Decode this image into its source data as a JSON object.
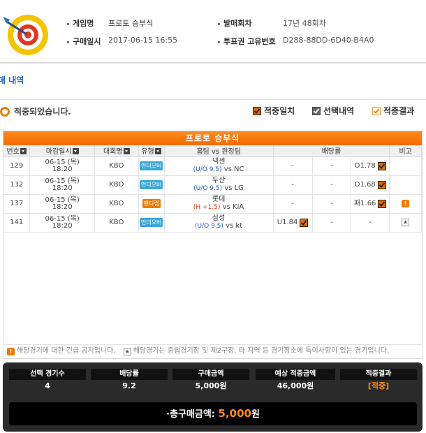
{
  "header": {
    "game_label": "게임명",
    "game_value": "프로토 승부식",
    "buy_time_label": "구매일시",
    "buy_time_value": "2017-06-15 16:55",
    "round_label": "발매회차",
    "round_value": "17년 48회차",
    "ticket_label": "투표권 고유번호",
    "ticket_value": "D288-88DD-6D40-B4A0"
  },
  "section_title": "매 내역",
  "status_text": "적중되었습니다.",
  "legend": {
    "hit": "적중일치",
    "selected": "선택내역",
    "result": "적중결과"
  },
  "table": {
    "title": "프로토 승부식",
    "headers": {
      "no": "번호",
      "deadline": "마감일시",
      "league": "대회명",
      "type": "유형",
      "teams": "홈팀 vs 원정팀",
      "odds": "배당률",
      "note": "비고"
    },
    "rows": [
      {
        "no": "129",
        "date": "06-15 (목)",
        "time": "18:20",
        "league": "KBO",
        "type": "언더오버",
        "home": "넥센",
        "sub": "(U/O 9.5)",
        "away": "vs NC",
        "o1": "-",
        "o2": "-",
        "o3": "O1.78",
        "note": ""
      },
      {
        "no": "132",
        "date": "06-15 (목)",
        "time": "18:20",
        "league": "KBO",
        "type": "언더오버",
        "home": "두산",
        "sub": "(U/O 9.5)",
        "away": "vs LG",
        "o1": "-",
        "o2": "-",
        "o3": "O1.68",
        "note": ""
      },
      {
        "no": "137",
        "date": "06-15 (목)",
        "time": "18:20",
        "league": "KBO",
        "type": "핸디캡",
        "home": "롯데",
        "sub": "(H +1.5)",
        "away": "vs KIA",
        "o1": "-",
        "o2": "-",
        "o3": "패1.66",
        "note": "!"
      },
      {
        "no": "141",
        "date": "06-15 (목)",
        "time": "18:20",
        "league": "KBO",
        "type": "언더오버",
        "home": "삼성",
        "sub": "(U/O 9.5)",
        "away": "vs kt",
        "o1": "U1.84",
        "o2": "-",
        "o3": "-",
        "note": "★"
      }
    ]
  },
  "notes": {
    "warn_icon": "!",
    "warn_text": "해당경기에 대한 긴급 공지입니다.",
    "star_icon": "★",
    "star_text": "해당경기는 중립경기장 및 제2구장, 타 지역 등 경기장소에 특이사항이 있는 경기입니다."
  },
  "summary": {
    "count_label": "선택 경기수",
    "count_value": "4",
    "odds_label": "배당률",
    "odds_value": "9.2",
    "buy_label": "구매금액",
    "buy_value": "5,000원",
    "expect_label": "예상 적중금액",
    "expect_value": "46,000원",
    "result_label": "적중결과",
    "result_value": "[적중]",
    "total_label": "·총구매금액:",
    "total_amount": "5,000",
    "total_unit": "원"
  },
  "colors": {
    "accent": "#f46a00",
    "link_blue": "#1d5fb7",
    "under_tag": "#3aa6d8",
    "handi_tag": "#f07a00"
  }
}
